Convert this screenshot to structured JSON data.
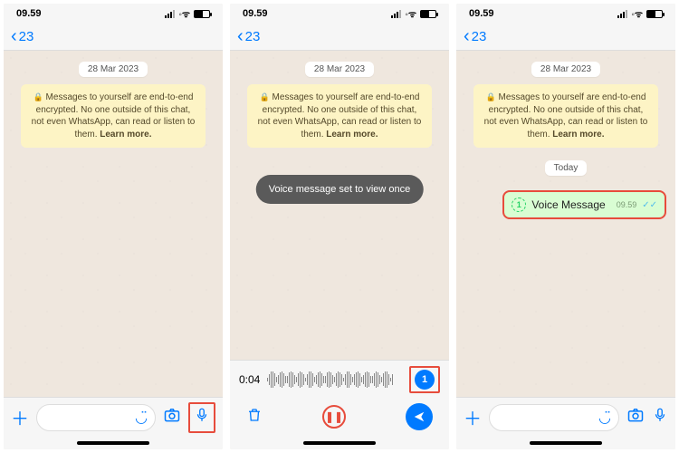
{
  "status": {
    "time": "09.59"
  },
  "nav": {
    "back": "23"
  },
  "chat": {
    "date": "28 Mar 2023",
    "encryption": "Messages to yourself are end-to-end encrypted. No one outside of this chat, not even WhatsApp, can read or listen to them.",
    "learn_more": "Learn more."
  },
  "p2": {
    "toast": "Voice message set to view once",
    "rec_time": "0:04"
  },
  "p3": {
    "today": "Today",
    "vmsg_label": "Voice Message",
    "vmsg_time": "09.59"
  }
}
